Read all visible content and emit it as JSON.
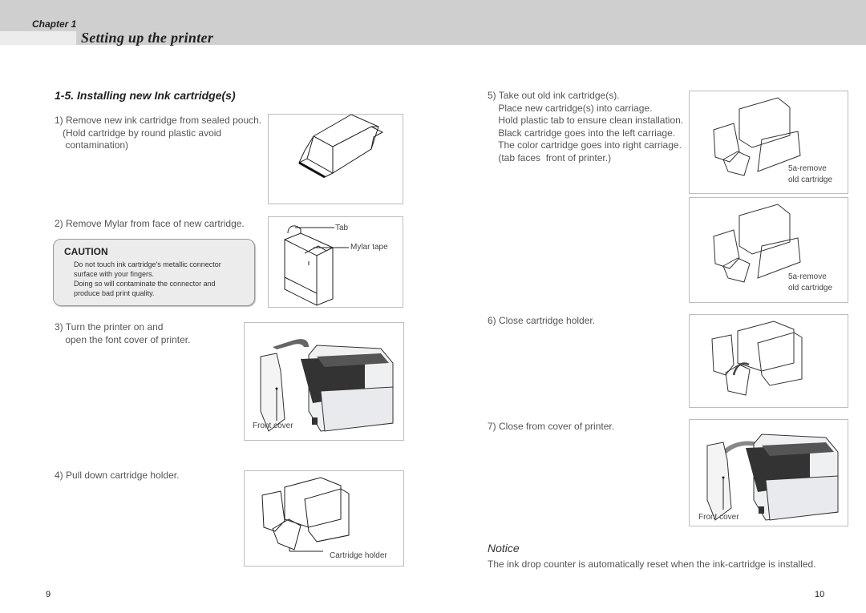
{
  "header": {
    "chapter": "Chapter 1",
    "title": "Setting up the printer"
  },
  "section": {
    "title": "1-5.  Installing new Ink cartridge(s)"
  },
  "steps": [
    {
      "text": "1) Remove new ink cartridge from sealed pouch.\n   (Hold cartridge by round plastic avoid\n    contamination)"
    },
    {
      "text": "2) Remove Mylar from face of new cartridge."
    },
    {
      "text": "3) Turn the printer on and\n    open the font cover of printer."
    },
    {
      "text": "4) Pull down cartridge holder."
    },
    {
      "text": "5) Take out old ink cartridge(s).\n    Place new cartridge(s) into carriage.\n    Hold plastic tab to ensure clean installation.\n    Black cartridge goes into the left carriage.\n    The color cartridge goes into right carriage.\n    (tab faces  front of printer.)"
    },
    {
      "text": "6) Close cartridge holder."
    },
    {
      "text": "7) Close from cover of printer."
    }
  ],
  "caution": {
    "title": "CAUTION",
    "body": "Do not touch ink cartridge's metallic connector\nsurface with your fingers.\nDoing so will contaminate the connector and\nproduce bad print quality."
  },
  "figures": {
    "fig2_tab": "Tab",
    "fig2_mylar": "Mylar tape",
    "fig3_label": "Front cover",
    "fig4_label": "Cartridge holder",
    "fig5a_label": "5a-remove\nold cartridge",
    "fig5b_label": "5a-remove\nold cartridge",
    "fig7_label": "Front cover"
  },
  "notice": {
    "title": "Notice",
    "body": "The ink drop counter is automatically reset when the ink-cartridge is installed."
  },
  "pages": {
    "left": "9",
    "right": "10"
  }
}
